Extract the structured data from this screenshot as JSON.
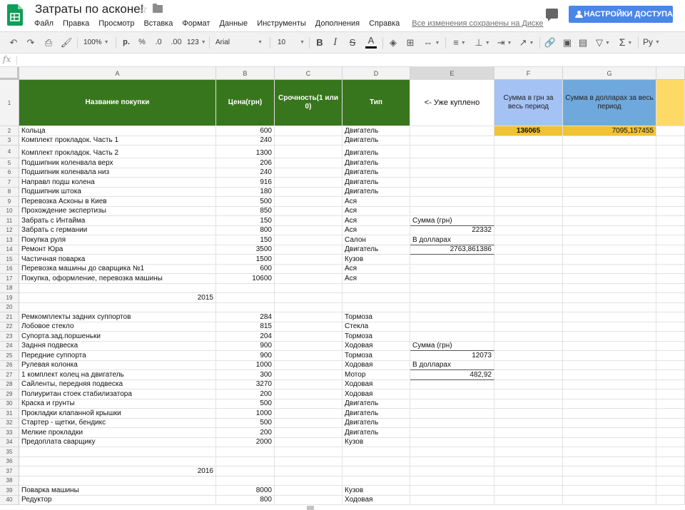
{
  "app": {
    "title": "Затраты по асконе!",
    "save_status": "Все изменения сохранены на Диске",
    "share_label": "НАСТРОЙКИ ДОСТУПА",
    "accent": "#4a86e8"
  },
  "menu": [
    "Файл",
    "Правка",
    "Просмотр",
    "Вставка",
    "Формат",
    "Данные",
    "Инструменты",
    "Дополнения",
    "Справка"
  ],
  "toolbar": {
    "zoom": "100%",
    "currency": "р.",
    "percent": "%",
    "dec_less": ".0",
    "dec_more": ".00",
    "more_formats": "123",
    "font": "Arial",
    "font_size": "10",
    "bold": "B",
    "italic": "I",
    "strike": "S",
    "text_color": "A",
    "sigma": "Σ",
    "input_lang": "Ру"
  },
  "formula_bar": {
    "fx": "fx"
  },
  "columns": [
    "A",
    "B",
    "C",
    "D",
    "E",
    "F",
    "G",
    ""
  ],
  "header": {
    "a": "Название покупки",
    "b": "Цена(грн)",
    "c": "Срочность(1 или 0)",
    "d": "Тип",
    "e": "<- Уже куплено",
    "f": "Сумма в грн за весь период",
    "g": "Сумма в долларах за весь период"
  },
  "rows": [
    {
      "n": "1"
    },
    {
      "n": "2",
      "a": "Кольца",
      "b": "600",
      "d": "Двигатель",
      "f": "136065",
      "g": "7095,157455"
    },
    {
      "n": "3",
      "a": "Комплект прокладок. Часть 1",
      "b": "240",
      "d": "Двигатель"
    },
    {
      "n": "4",
      "a": "Комплект прокладок. Часть 2",
      "b": "1300",
      "d": "Двигатель"
    },
    {
      "n": "5",
      "a": "Подшипник коленвала верх",
      "b": "206",
      "d": "Двигатель"
    },
    {
      "n": "6",
      "a": "Подшипник коленвала низ",
      "b": "240",
      "d": "Двигатель"
    },
    {
      "n": "7",
      "a": "Направл подш колена",
      "b": "916",
      "d": "Двигатель"
    },
    {
      "n": "8",
      "a": "Подшипник штока",
      "b": "180",
      "d": "Двигатель"
    },
    {
      "n": "9",
      "a": "Перевозка Асконы в Киев",
      "b": "500",
      "d": "Ася"
    },
    {
      "n": "10",
      "a": "Прохождение экспертизы",
      "b": "850",
      "d": "Ася"
    },
    {
      "n": "11",
      "a": "Забрать с Интайма",
      "b": "150",
      "d": "Ася",
      "e": "Сумма (грн)"
    },
    {
      "n": "12",
      "a": "Забрать с германии",
      "b": "800",
      "d": "Ася",
      "e": "22332"
    },
    {
      "n": "13",
      "a": "Покупка руля",
      "b": "150",
      "d": "Салон",
      "e": "В долларах"
    },
    {
      "n": "14",
      "a": "Ремонт Юра",
      "b": "3500",
      "d": "Двигатель",
      "e": "2763,861386"
    },
    {
      "n": "15",
      "a": "Частичная поварка",
      "b": "1500",
      "d": "Кузов"
    },
    {
      "n": "16",
      "a": "Перевозка машины до сварщика №1",
      "b": "600",
      "d": "Ася"
    },
    {
      "n": "17",
      "a": "Покупка, оформление, перевозка машины",
      "b": "10600",
      "d": "Ася"
    },
    {
      "n": "18"
    },
    {
      "n": "19",
      "a": "2015"
    },
    {
      "n": "20"
    },
    {
      "n": "21",
      "a": "Ремкомплекты задних суппортов",
      "b": "284",
      "d": "Тормоза"
    },
    {
      "n": "22",
      "a": "Лобовое стекло",
      "b": "815",
      "d": "Стекла"
    },
    {
      "n": "23",
      "a": "Супорта.зад.поршеньки",
      "b": "204",
      "d": "Тормоза"
    },
    {
      "n": "24",
      "a": "Задння подвеска",
      "b": "900",
      "d": "Ходовая",
      "e": "Сумма (грн)"
    },
    {
      "n": "25",
      "a": "Передние суппорта",
      "b": "900",
      "d": "Тормоза",
      "e": "12073"
    },
    {
      "n": "26",
      "a": "Рулевая колонка",
      "b": "1000",
      "d": "Ходовая",
      "e": "В долларах"
    },
    {
      "n": "27",
      "a": "1 комплект колец на двигатель",
      "b": "300",
      "d": "Мотор",
      "e": "482,92"
    },
    {
      "n": "28",
      "a": "Сайленты, передняя подвеска",
      "b": "3270",
      "d": "Ходовая"
    },
    {
      "n": "29",
      "a": "Полиуритан стоек стабилизатора",
      "b": "200",
      "d": "Ходовая"
    },
    {
      "n": "30",
      "a": "Краска  и грунты",
      "b": "500",
      "d": "Двигатель"
    },
    {
      "n": "31",
      "a": "Прокладки клапанной крышки",
      "b": "1000",
      "d": "Двигатель"
    },
    {
      "n": "32",
      "a": "Стартер - щетки, бендикс",
      "b": "500",
      "d": "Двигатель"
    },
    {
      "n": "33",
      "a": "Мелкие прокладки",
      "b": "200",
      "d": "Двигатель"
    },
    {
      "n": "34",
      "a": "Предоплата сварщику",
      "b": "2000",
      "d": "Кузов"
    },
    {
      "n": "35"
    },
    {
      "n": "36"
    },
    {
      "n": "37",
      "a": "2016"
    },
    {
      "n": "38"
    },
    {
      "n": "39",
      "a": "Поварка машины",
      "b": "8000",
      "d": "Кузов"
    },
    {
      "n": "40",
      "a": "Редуктор",
      "b": "800",
      "d": "Ходовая"
    }
  ]
}
